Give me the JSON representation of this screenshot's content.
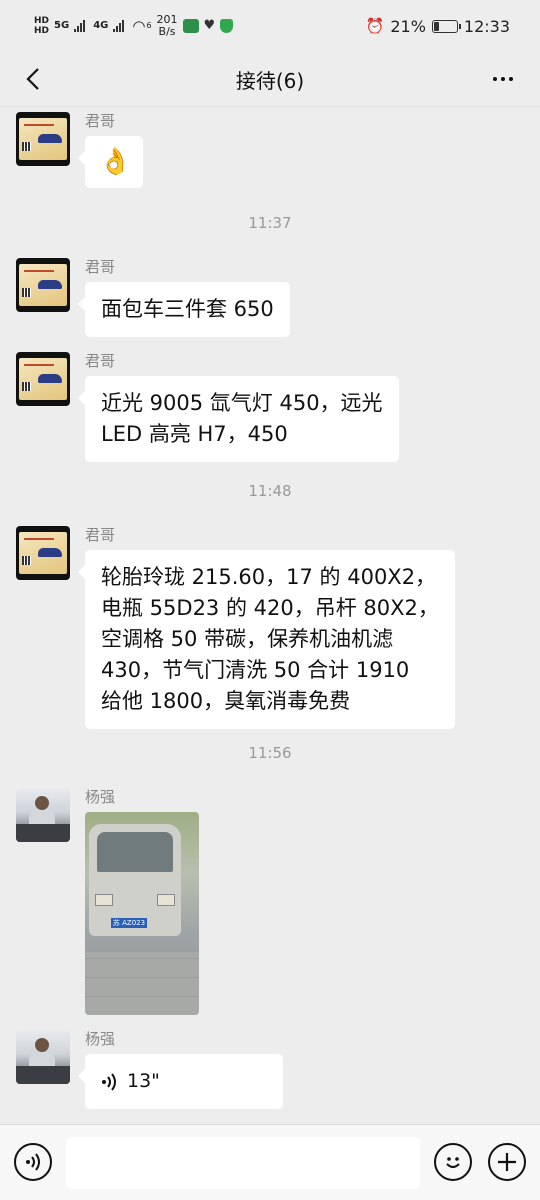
{
  "status_bar": {
    "hd1": "HD",
    "net1": "5G",
    "hd2": "HD",
    "net2": "4G",
    "wifi_sub": "6",
    "speed_value": "201",
    "speed_unit": "B/s",
    "battery": "21%",
    "time": "12:33"
  },
  "nav": {
    "title": "接待(6)"
  },
  "messages": [
    {
      "sender": "君哥",
      "emoji": "👌"
    },
    {
      "sender": "君哥",
      "lines": [
        "面包车三件套 650"
      ]
    },
    {
      "sender": "君哥",
      "lines": [
        "近光 9005 氙气灯 450，远光",
        "LED 高亮 H7，450"
      ]
    },
    {
      "sender": "君哥",
      "lines": [
        "轮胎玲珑 215.60，17 的 400X2，",
        "电瓶 55D23 的 420，吊杆 80X2，",
        "空调格 50 带碳，保养机油机滤",
        "430，节气门清洗 50 合计 1910",
        "给他 1800，臭氧消毒免费"
      ]
    },
    {
      "sender": "杨强",
      "plate": "苏 AZ023"
    },
    {
      "sender": "杨强",
      "voice_duration": "13\""
    }
  ],
  "timestamps": [
    "11:37",
    "11:48",
    "11:56"
  ]
}
